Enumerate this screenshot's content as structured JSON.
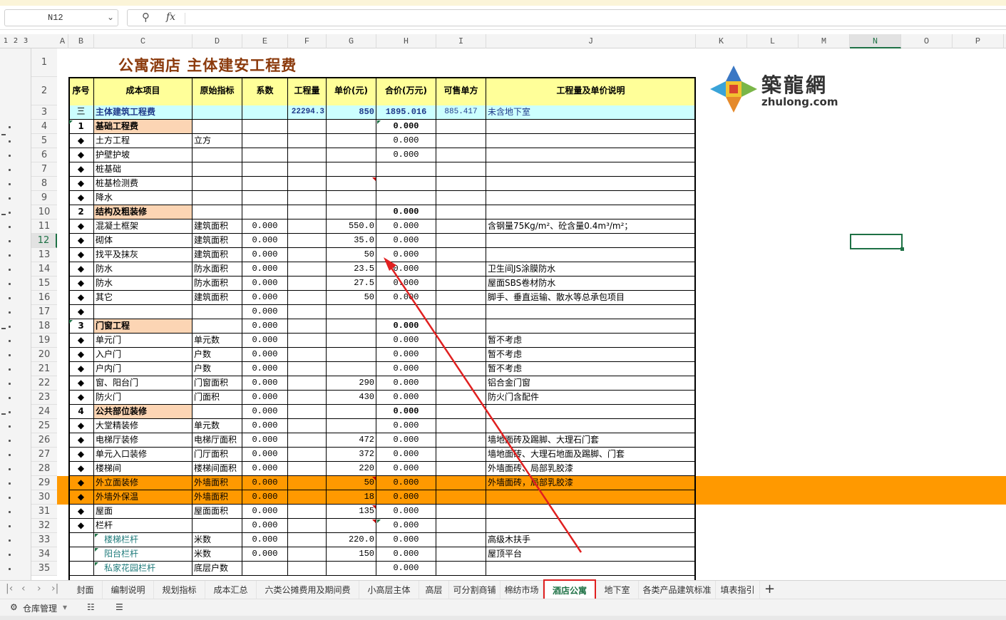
{
  "namebox": {
    "value": "N12"
  },
  "formula": {
    "fx_label": "fx",
    "value": ""
  },
  "columns": [
    "A",
    "B",
    "C",
    "D",
    "E",
    "F",
    "G",
    "H",
    "I",
    "J",
    "K",
    "L",
    "M",
    "N",
    "O",
    "P"
  ],
  "selected_column": "N",
  "outline_levels": [
    "1",
    "2",
    "3"
  ],
  "rows": [
    "1",
    "2",
    "3",
    "4",
    "5",
    "6",
    "7",
    "8",
    "9",
    "10",
    "11",
    "12",
    "13",
    "14",
    "15",
    "16",
    "17",
    "18",
    "19",
    "20",
    "21",
    "22",
    "23",
    "24",
    "25",
    "26",
    "27",
    "28",
    "29",
    "30",
    "31",
    "32",
    "33",
    "34",
    "35"
  ],
  "selected_row": "12",
  "sheet": {
    "title": "公寓酒店  主体建安工程费",
    "headers": [
      "序号",
      "成本项目",
      "原始指标",
      "系数",
      "工程量",
      "单价(元)",
      "合价(万元)",
      "可售单方",
      "工程量及单价说明"
    ],
    "summary": {
      "seq": "三",
      "item": "主体建筑工程费",
      "qty": "22294.3",
      "price": "850",
      "total": "1895.016",
      "unit": "885.417",
      "note": "未含地下室"
    },
    "body": [
      {
        "seq": "1",
        "item": "基础工程费",
        "ind": "",
        "coef": "",
        "qty": "",
        "price": "",
        "total": "0.000",
        "note": "",
        "type": "section"
      },
      {
        "seq": "◆",
        "item": "土方工程",
        "ind": "立方",
        "coef": "",
        "qty": "",
        "price": "",
        "total": "0.000",
        "note": ""
      },
      {
        "seq": "◆",
        "item": "护壁护坡",
        "ind": "",
        "coef": "",
        "qty": "",
        "price": "",
        "total": "0.000",
        "note": ""
      },
      {
        "seq": "◆",
        "item": "桩基础",
        "ind": "",
        "coef": "",
        "qty": "",
        "price": "",
        "total": "",
        "note": ""
      },
      {
        "seq": "◆",
        "item": "桩基检测费",
        "ind": "",
        "coef": "",
        "qty": "",
        "price": "",
        "total": "",
        "note": ""
      },
      {
        "seq": "◆",
        "item": "降水",
        "ind": "",
        "coef": "",
        "qty": "",
        "price": "",
        "total": "",
        "note": ""
      },
      {
        "seq": "2",
        "item": "结构及粗装修",
        "ind": "",
        "coef": "",
        "qty": "",
        "price": "",
        "total": "0.000",
        "note": "",
        "type": "section"
      },
      {
        "seq": "◆",
        "item": "混凝土框架",
        "ind": "建筑面积",
        "coef": "0.000",
        "qty": "",
        "price": "550.0",
        "total": "0.000",
        "note": "含钢量75Kg/m²、砼含量0.4m³/m²；"
      },
      {
        "seq": "◆",
        "item": "砌体",
        "ind": "建筑面积",
        "coef": "0.000",
        "qty": "",
        "price": "35.0",
        "total": "0.000",
        "note": ""
      },
      {
        "seq": "◆",
        "item": "找平及抹灰",
        "ind": "建筑面积",
        "coef": "0.000",
        "qty": "",
        "price": "50",
        "total": "0.000",
        "note": ""
      },
      {
        "seq": "◆",
        "item": "防水",
        "ind": "防水面积",
        "coef": "0.000",
        "qty": "",
        "price": "23.5",
        "total": "0.000",
        "note": "卫生间JS涂膜防水"
      },
      {
        "seq": "◆",
        "item": "防水",
        "ind": "防水面积",
        "coef": "0.000",
        "qty": "",
        "price": "27.5",
        "total": "0.000",
        "note": "屋面SBS卷材防水"
      },
      {
        "seq": "◆",
        "item": "其它",
        "ind": "建筑面积",
        "coef": "0.000",
        "qty": "",
        "price": "50",
        "total": "0.000",
        "note": "脚手、垂直运输、散水等总承包项目"
      },
      {
        "seq": "◆",
        "item": "",
        "ind": "",
        "coef": "0.000",
        "qty": "",
        "price": "",
        "total": "",
        "note": ""
      },
      {
        "seq": "3",
        "item": "门窗工程",
        "ind": "",
        "coef": "0.000",
        "qty": "",
        "price": "",
        "total": "0.000",
        "note": "",
        "type": "section"
      },
      {
        "seq": "◆",
        "item": "单元门",
        "ind": "单元数",
        "coef": "0.000",
        "qty": "",
        "price": "",
        "total": "0.000",
        "note": "暂不考虑"
      },
      {
        "seq": "◆",
        "item": "入户门",
        "ind": "户数",
        "coef": "0.000",
        "qty": "",
        "price": "",
        "total": "0.000",
        "note": "暂不考虑"
      },
      {
        "seq": "◆",
        "item": "户内门",
        "ind": "户数",
        "coef": "0.000",
        "qty": "",
        "price": "",
        "total": "0.000",
        "note": "暂不考虑"
      },
      {
        "seq": "◆",
        "item": "窗、阳台门",
        "ind": "门窗面积",
        "coef": "0.000",
        "qty": "",
        "price": "290",
        "total": "0.000",
        "note": "铝合金门窗"
      },
      {
        "seq": "◆",
        "item": "防火门",
        "ind": "门面积",
        "coef": "0.000",
        "qty": "",
        "price": "430",
        "total": "0.000",
        "note": "防火门含配件"
      },
      {
        "seq": "4",
        "item": "公共部位装修",
        "ind": "",
        "coef": "0.000",
        "qty": "",
        "price": "",
        "total": "0.000",
        "note": "",
        "type": "section"
      },
      {
        "seq": "◆",
        "item": "大堂精装修",
        "ind": "单元数",
        "coef": "0.000",
        "qty": "",
        "price": "",
        "total": "0.000",
        "note": ""
      },
      {
        "seq": "◆",
        "item": "电梯厅装修",
        "ind": "电梯厅面积",
        "coef": "0.000",
        "qty": "",
        "price": "472",
        "total": "0.000",
        "note": "墙地面砖及踢脚、大理石门套"
      },
      {
        "seq": "◆",
        "item": "单元入口装修",
        "ind": "门厅面积",
        "coef": "0.000",
        "qty": "",
        "price": "372",
        "total": "0.000",
        "note": "墙地面砖、大理石地面及踢脚、门套"
      },
      {
        "seq": "◆",
        "item": "楼梯间",
        "ind": "楼梯间面积",
        "coef": "0.000",
        "qty": "",
        "price": "220",
        "total": "0.000",
        "note": "外墙面砖、局部乳胶漆"
      },
      {
        "seq": "◆",
        "item": "外立面装修",
        "ind": "外墙面积",
        "coef": "0.000",
        "qty": "",
        "price": "50",
        "total": "0.000",
        "note": "外墙面砖，局部乳胶漆",
        "type": "hl"
      },
      {
        "seq": "◆",
        "item": "外墙外保温",
        "ind": "外墙面积",
        "coef": "0.000",
        "qty": "",
        "price": "18",
        "total": "0.000",
        "note": "",
        "type": "hl"
      },
      {
        "seq": "◆",
        "item": "屋面",
        "ind": "屋面面积",
        "coef": "0.000",
        "qty": "",
        "price": "135",
        "total": "0.000",
        "note": ""
      },
      {
        "seq": "◆",
        "item": "栏杆",
        "ind": "",
        "coef": "0.000",
        "qty": "",
        "price": "",
        "total": "0.000",
        "note": ""
      },
      {
        "seq": "",
        "item": "楼梯栏杆",
        "ind": "米数",
        "coef": "0.000",
        "qty": "",
        "price": "220.0",
        "total": "0.000",
        "note": "高级木扶手",
        "type": "sub"
      },
      {
        "seq": "",
        "item": "阳台栏杆",
        "ind": "米数",
        "coef": "0.000",
        "qty": "",
        "price": "150",
        "total": "0.000",
        "note": "屋顶平台",
        "type": "sub"
      },
      {
        "seq": "",
        "item": "私家花园栏杆",
        "ind": "底层户数",
        "coef": "",
        "qty": "",
        "price": "",
        "total": "0.000",
        "note": "",
        "type": "sub"
      }
    ]
  },
  "logo": {
    "cn": "築龍網",
    "url": "zhulong.com"
  },
  "tabs": [
    "封面",
    "编制说明",
    "规划指标",
    "成本汇总",
    "六类公摊费用及期间费",
    "小高层主体",
    "高层",
    "可分割商铺",
    "棉纺市场",
    "酒店公寓",
    "地下室",
    "各类产品建筑标准",
    "填表指引"
  ],
  "active_tab": "酒店公寓",
  "tab_add": "+",
  "status": {
    "warehouse": "仓库管理"
  },
  "colors": {
    "section_fill": "#fcd5b4",
    "header_fill": "#ffff99",
    "summary_fill": "#ccffff",
    "highlight_row": "#ff9900",
    "accent": "#1e7145",
    "arrow": "#e02020"
  }
}
